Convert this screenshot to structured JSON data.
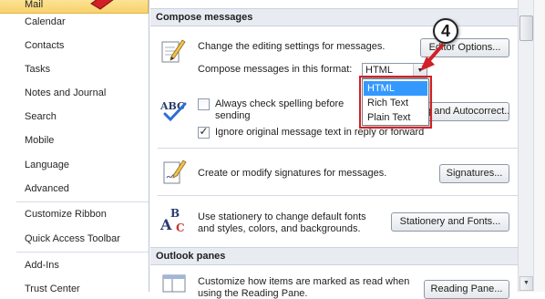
{
  "sidebar": {
    "items": [
      {
        "label": "Mail",
        "selected": true
      },
      {
        "label": "Calendar"
      },
      {
        "label": "Contacts"
      },
      {
        "label": "Tasks"
      },
      {
        "label": "Notes and Journal"
      },
      {
        "label": "Search"
      },
      {
        "label": "Mobile"
      },
      {
        "label": "Language"
      },
      {
        "label": "Advanced"
      },
      {
        "label": "Customize Ribbon"
      },
      {
        "label": "Quick Access Toolbar"
      },
      {
        "label": "Add-Ins"
      },
      {
        "label": "Trust Center"
      }
    ]
  },
  "compose": {
    "header": "Compose messages",
    "editing_text": "Change the editing settings for messages.",
    "editor_options_label": "Editor Options...",
    "format_label": "Compose messages in this format:",
    "format_value": "HTML",
    "format_options": [
      "HTML",
      "Rich Text",
      "Plain Text"
    ],
    "spelling_label_line1": "Always check spelling before",
    "spelling_label_line2": "sending",
    "spelling_checked": false,
    "autocorrect_label": "Spelling and Autocorrect...",
    "ignore_label": "Ignore original message text in reply or forward",
    "ignore_checked": true,
    "signature_text": "Create or modify signatures for messages.",
    "signatures_button": "Signatures...",
    "stationery_line1": "Use stationery to change default fonts",
    "stationery_line2": "and styles, colors, and backgrounds.",
    "stationery_button": "Stationery and Fonts..."
  },
  "panes": {
    "header": "Outlook panes",
    "reading_line1": "Customize how items are marked as read when",
    "reading_line2": "using the Reading Pane.",
    "reading_button": "Reading Pane..."
  },
  "annotation": {
    "step_number": "4",
    "highlight_color": "#d12027"
  },
  "icons": {
    "editing": "pen-paper-icon",
    "spelling": "abc-check-icon",
    "signature": "signature-pen-icon",
    "stationery": "stationery-abc-icon",
    "reading": "reading-pane-icon"
  },
  "colors": {
    "selected_nav": "#f8d26b",
    "section_header_bg": "#e8ecf2",
    "dropdown_selected": "#3399ff"
  }
}
